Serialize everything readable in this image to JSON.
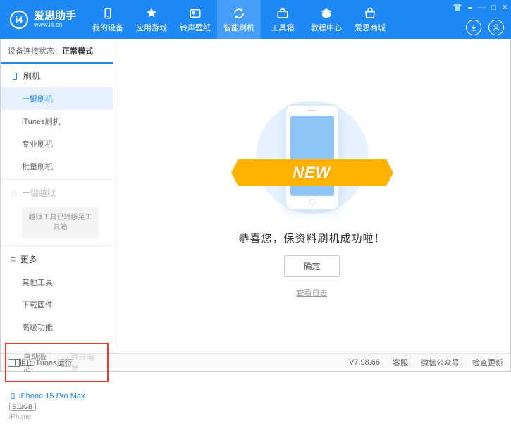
{
  "app": {
    "title": "爱思助手",
    "subtitle": "www.i4.cn"
  },
  "topnav": {
    "items": [
      {
        "label": "我的设备"
      },
      {
        "label": "应用游戏"
      },
      {
        "label": "铃声壁纸"
      },
      {
        "label": "智能刷机"
      },
      {
        "label": "工具箱"
      },
      {
        "label": "教程中心"
      },
      {
        "label": "爱思商城"
      }
    ]
  },
  "connection": {
    "label": "设备连接状态：",
    "value": "正常模式"
  },
  "sidebar": {
    "flash_head": "刷机",
    "items": [
      {
        "label": "一键刷机"
      },
      {
        "label": "iTunes刷机"
      },
      {
        "label": "专业刷机"
      },
      {
        "label": "批量刷机"
      }
    ],
    "jailbreak_head": "一键越狱",
    "jailbreak_note": "越狱工具已转移至工具箱",
    "more_head": "更多",
    "more_items": [
      {
        "label": "其他工具"
      },
      {
        "label": "下载固件"
      },
      {
        "label": "高级功能"
      }
    ],
    "auto_activate": "自动激活",
    "skip_guide": "跳过向导"
  },
  "device": {
    "name": "iPhone 15 Pro Max",
    "storage": "512GB",
    "type": "iPhone"
  },
  "main": {
    "ribbon": "NEW",
    "success": "恭喜您，保资料刷机成功啦！",
    "ok": "确定",
    "view_log": "查看日志"
  },
  "footer": {
    "block_itunes": "阻止iTunes运行",
    "version": "V7.98.66",
    "links": [
      {
        "label": "客服"
      },
      {
        "label": "微信公众号"
      },
      {
        "label": "检查更新"
      }
    ]
  }
}
